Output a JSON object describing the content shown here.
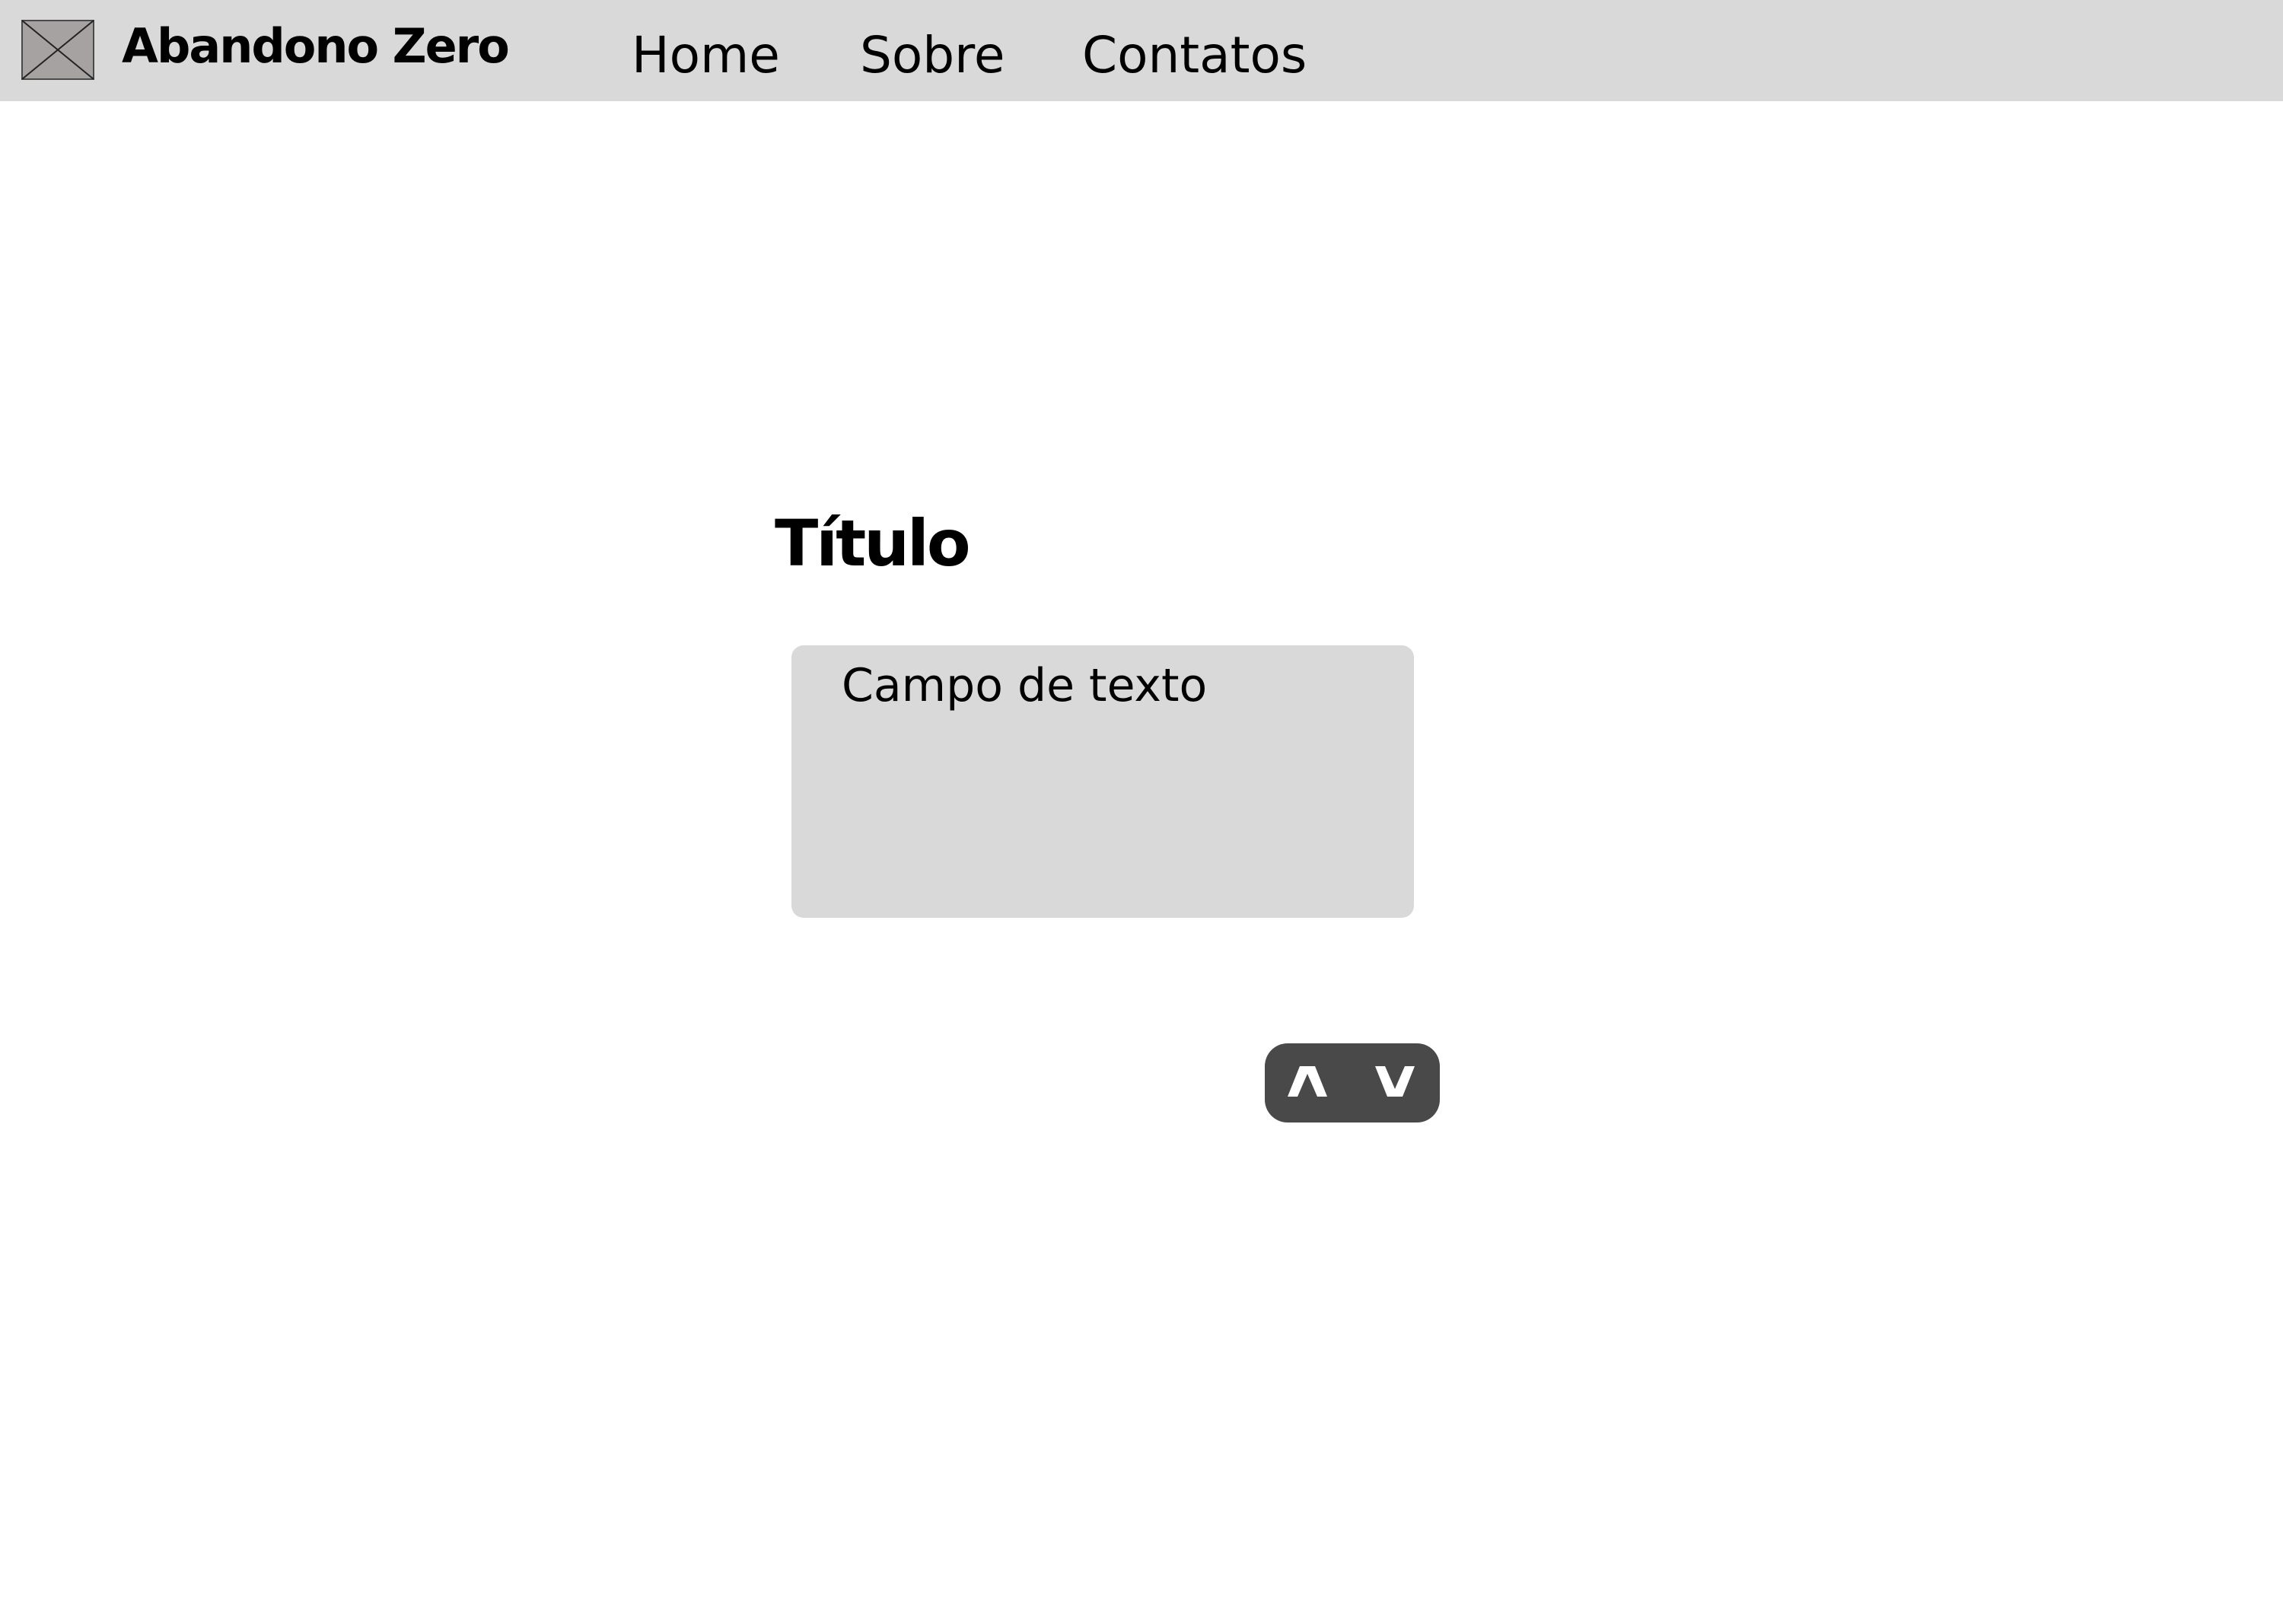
{
  "header": {
    "logo_icon": "image-placeholder-icon",
    "brand": "Abandono Zero",
    "nav": {
      "home": "Home",
      "sobre": "Sobre",
      "contatos": "Contatos"
    }
  },
  "main": {
    "title": "Título",
    "text_field": {
      "value": "Campo de texto"
    },
    "stepper": {
      "up_icon": "chevron-up-icon",
      "down_icon": "chevron-down-icon"
    }
  },
  "colors": {
    "navbar_bg": "#d9d9d9",
    "field_bg": "#d9d9d9",
    "stepper_bg": "#4a4949",
    "text": "#000000",
    "icon": "#ffffff"
  }
}
